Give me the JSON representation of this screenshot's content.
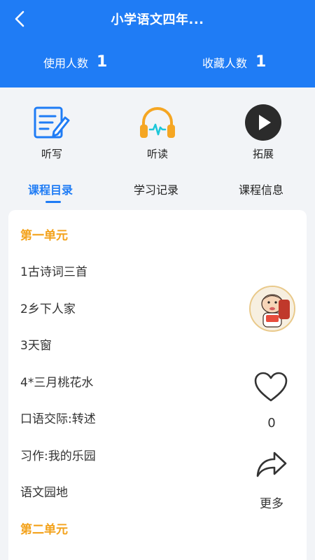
{
  "header": {
    "title": "小学语文四年...",
    "stats": {
      "users_label": "使用人数",
      "users_value": "1",
      "favorites_label": "收藏人数",
      "favorites_value": "1"
    }
  },
  "features": [
    {
      "label": "听写",
      "icon": "pencil-note-icon"
    },
    {
      "label": "听读",
      "icon": "headphones-icon"
    },
    {
      "label": "拓展",
      "icon": "play-circle-icon"
    }
  ],
  "tabs": [
    {
      "label": "课程目录",
      "active": true
    },
    {
      "label": "学习记录",
      "active": false
    },
    {
      "label": "课程信息",
      "active": false
    }
  ],
  "catalog": {
    "unit1_title": "第一单元",
    "lessons": [
      "1古诗词三首",
      "2乡下人家",
      "3天窗",
      "4*三月桃花水",
      "口语交际:转述",
      "习作:我的乐园",
      "语文园地"
    ],
    "unit2_title": "第二单元"
  },
  "actions": {
    "like_count": "0",
    "more_label": "更多"
  },
  "colors": {
    "primary": "#1f7cf5",
    "unit_title": "#f3a21b",
    "headphones": "#f5a623",
    "waveform": "#1ec7d9"
  }
}
